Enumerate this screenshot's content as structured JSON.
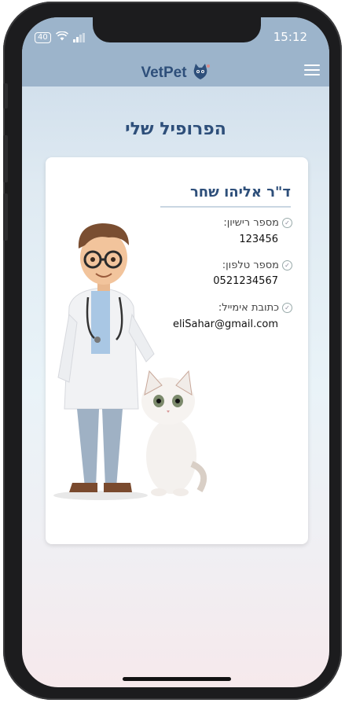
{
  "status_bar": {
    "battery": "40",
    "time": "15:12"
  },
  "header": {
    "brand": "VetPet"
  },
  "page": {
    "title": "הפרופיל שלי"
  },
  "profile": {
    "name": "ד\"ר אליהו שחר",
    "fields": [
      {
        "label": "מספר רישיון:",
        "value": "123456"
      },
      {
        "label": "מספר טלפון:",
        "value": "0521234567"
      },
      {
        "label": "כתובת אימייל:",
        "value": "eliSahar@gmail.com"
      }
    ]
  },
  "colors": {
    "header": "#9cb4cb",
    "accent": "#2e4f7a"
  },
  "icons": [
    "wifi-icon",
    "signal-icon",
    "battery-icon",
    "cat-logo-icon",
    "menu-icon",
    "check-icon"
  ]
}
